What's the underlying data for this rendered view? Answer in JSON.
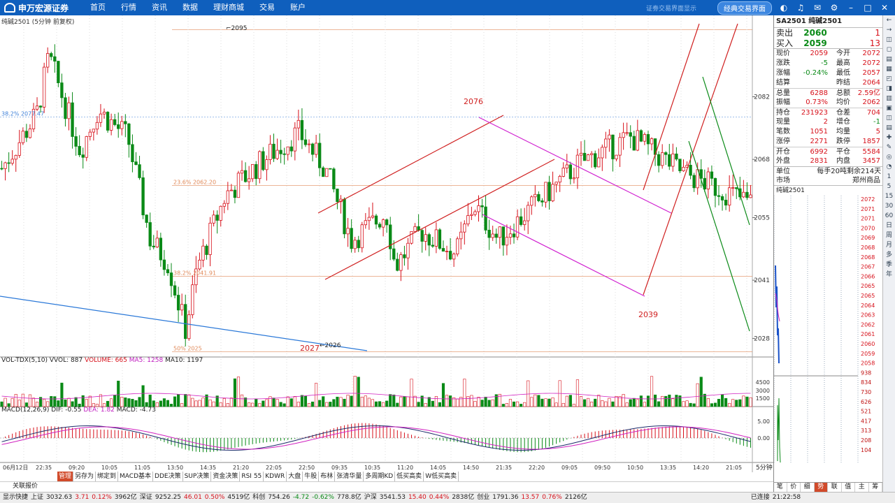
{
  "topbar": {
    "logo": "申万宏源证券",
    "nav": [
      "首页",
      "行情",
      "资讯",
      "数据",
      "理财商城",
      "交易",
      "账户"
    ],
    "msg": "证劵交易界面显示",
    "classic_btn": "经典交易界面"
  },
  "chart": {
    "title": "纯碱2501 (5分钟 前复权)",
    "price_labels": [
      "2082",
      "2068",
      "2055",
      "2041",
      "2028"
    ],
    "fib_labels": [
      "38.2% 2077.47",
      "23.6% 2062.20",
      "38.2% 2041.91",
      "50% 2025"
    ],
    "annotations": {
      "high": "2095",
      "low": "2026",
      "p2076": "2076",
      "p2039": "2039",
      "p2027": "2027"
    },
    "time_labels": [
      "06月12日",
      "22:35",
      "09:20",
      "10:05",
      "11:05",
      "13:50",
      "14:35",
      "21:20",
      "22:05",
      "22:50",
      "09:35",
      "10:35",
      "11:20",
      "14:05",
      "14:50",
      "21:35",
      "22:20",
      "09:05",
      "09:50",
      "10:50",
      "13:35",
      "14:20",
      "21:05"
    ],
    "period": "5分钟"
  },
  "ind1": {
    "title": "VOL-TDX(5,10)",
    "vol": "VVOL: 887",
    "volume": "VOLUME: 665",
    "ma5": "MA5: 1258",
    "ma10": "MA10: 1197",
    "scale": [
      "4500",
      "3000",
      "1500"
    ]
  },
  "ind2": {
    "title": "MACD(12,26,9)",
    "dif": "DIF: -0.55",
    "dea": "DEA: 1.82",
    "macd": "MACD: -4.73",
    "scale": [
      "5.00",
      "0.00"
    ]
  },
  "bottom_tabs": [
    "管理",
    "另存为",
    "绑定到",
    "MACD基本",
    "DDE决策",
    "SUP决策",
    "资金决策",
    "RSI 55",
    "KDWR",
    "大盘",
    "牛股",
    "布林",
    "张清华量",
    "多周期KD",
    "低买高卖",
    "W低买高卖"
  ],
  "relquote": "关联报价",
  "status": {
    "items": [
      "显示快捷",
      "上证",
      "3032.63",
      "3.71",
      "0.12%",
      "3962亿",
      "深证",
      "9252.25",
      "46.01",
      "0.50%",
      "4519亿",
      "科创",
      "754.26",
      "-4.72",
      "-0.62%",
      "778.8亿",
      "沪深",
      "3541.53",
      "15.40",
      "0.44%",
      "2838亿",
      "创业",
      "1791.36",
      "13.57",
      "0.76%",
      "2126亿",
      "已连接",
      "21:22:58"
    ]
  },
  "quote": {
    "code": "SA2501",
    "name": "纯碱2501",
    "sell": {
      "label": "卖出",
      "price": "2060",
      "qty": "1"
    },
    "buy": {
      "label": "买入",
      "price": "2059",
      "qty": "13"
    },
    "rows": [
      [
        "现价",
        "2059",
        "今开",
        "2072"
      ],
      [
        "涨跌",
        "-5",
        "最高",
        "2072"
      ],
      [
        "涨幅",
        "-0.24%",
        "最低",
        "2057"
      ],
      [
        "结算",
        "",
        "昨结",
        "2064"
      ],
      [
        "总量",
        "6288",
        "总额",
        "2.59亿"
      ],
      [
        "振幅",
        "0.73%",
        "均价",
        "2062"
      ],
      [
        "持仓",
        "231923",
        "仓差",
        "704"
      ],
      [
        "现量",
        "2",
        "增仓",
        "-1"
      ],
      [
        "笔数",
        "1051",
        "均量",
        "5"
      ],
      [
        "涨停",
        "2271",
        "跌停",
        "1857"
      ],
      [
        "开仓",
        "6992",
        "平仓",
        "5584"
      ],
      [
        "外盘",
        "2831",
        "内盘",
        "3457"
      ]
    ],
    "unit": [
      "单位",
      "每手20吨",
      "剩余214天"
    ],
    "market": [
      "市场",
      "郑州商品"
    ],
    "mini_title": "纯碱2501",
    "mini_prices": [
      "2072",
      "2071",
      "2071",
      "2070",
      "2069",
      "2068",
      "2068",
      "2067",
      "2066",
      "2065",
      "2065",
      "2064",
      "2063",
      "2062",
      "2061",
      "2060",
      "2059",
      "2058",
      "938",
      "834",
      "730",
      "626",
      "521",
      "417",
      "313",
      "208",
      "104"
    ]
  },
  "rb_tabs": [
    "笔",
    "价",
    "细",
    "势",
    "联",
    "值",
    "主",
    "筹"
  ],
  "sidebar": [
    "←",
    "→",
    "◫",
    "◻",
    "▤",
    "▦",
    "◰",
    "◨",
    "▥",
    "▣",
    "◫",
    "▤",
    "✚",
    "✎",
    "◎",
    "◔",
    "1",
    "5",
    "15",
    "30",
    "60",
    "日",
    "周",
    "月",
    "多",
    "季",
    "年"
  ],
  "colors": {
    "up": "#d7101a",
    "down": "#0a8a17",
    "accent": "#0f5fbd"
  }
}
